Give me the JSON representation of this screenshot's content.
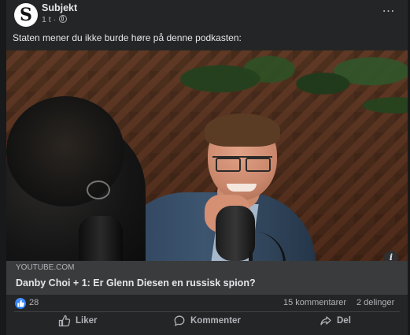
{
  "page": {
    "name": "Subjekt",
    "timestamp": "1 t",
    "meta_separator": " · ",
    "avatar_letter": "S",
    "more_icon": "⋯"
  },
  "post": {
    "text": "Staten mener du ikke burde høre på denne podkasten:",
    "image_alt": "Danby Choi + 1 podcast episode thumbnail"
  },
  "link": {
    "domain": "YOUTUBE.COM",
    "title": "Danby Choi + 1: Er Glenn Diesen en russisk spion?",
    "info_icon": "i"
  },
  "engagement": {
    "reaction_count": "28",
    "comments": "15 kommentarer",
    "shares": "2 delinger"
  },
  "actions": {
    "like": "Liker",
    "comment": "Kommenter",
    "share": "Del"
  },
  "colors": {
    "background": "#18191a",
    "card": "#242526",
    "link_box": "#3a3b3c",
    "text": "#e4e6eb",
    "secondary_text": "#b0b3b8",
    "like_blue": "#1877f2"
  }
}
